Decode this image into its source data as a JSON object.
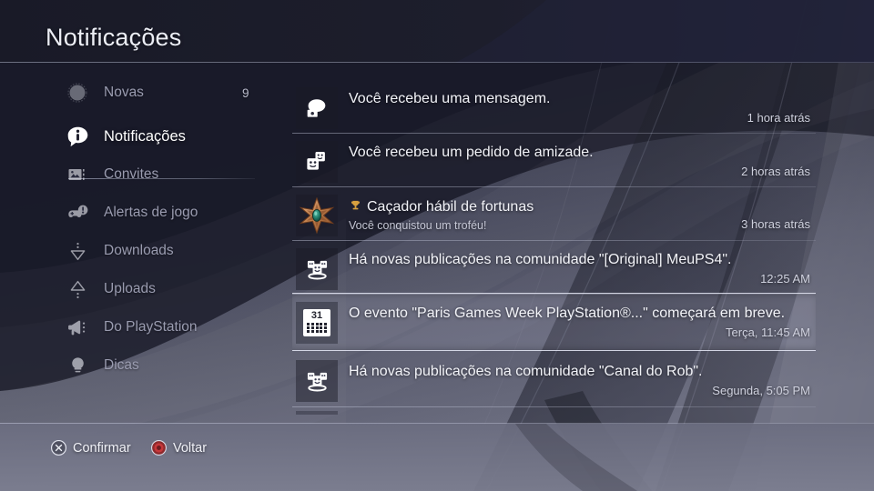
{
  "header": {
    "title": "Notificações"
  },
  "sidebar": {
    "divider_after_index": 0,
    "items": [
      {
        "label": "Novas",
        "icon": "new-dot-icon",
        "badge": "9",
        "active": false
      },
      {
        "label": "Notificações",
        "icon": "info-bubble-icon",
        "badge": "",
        "active": true
      },
      {
        "label": "Convites",
        "icon": "ticket-icon",
        "badge": "",
        "active": false
      },
      {
        "label": "Alertas de jogo",
        "icon": "controller-alert-icon",
        "badge": "",
        "active": false
      },
      {
        "label": "Downloads",
        "icon": "download-arrow-icon",
        "badge": "",
        "active": false
      },
      {
        "label": "Uploads",
        "icon": "upload-arrow-icon",
        "badge": "",
        "active": false
      },
      {
        "label": "Do PlayStation",
        "icon": "megaphone-icon",
        "badge": "",
        "active": false
      },
      {
        "label": "Dicas",
        "icon": "lightbulb-icon",
        "badge": "",
        "active": false
      }
    ]
  },
  "notifications": {
    "items": [
      {
        "icon": "message-bubble-icon",
        "title": "Você recebeu uma mensagem.",
        "subtitle": "",
        "time": "1 hora atrás",
        "selected": false
      },
      {
        "icon": "friend-request-icon",
        "title": "Você recebeu um pedido de amizade.",
        "subtitle": "",
        "time": "2 horas atrás",
        "selected": false
      },
      {
        "icon": "trophy-badge-icon",
        "title": "Caçador hábil de fortunas",
        "title_prefix_icon": "trophy-cup-icon",
        "subtitle": "Você conquistou um troféu!",
        "time": "3 horas atrás",
        "selected": false
      },
      {
        "icon": "community-icon",
        "title": "Há novas publicações na comunidade \"[Original] MeuPS4\".",
        "subtitle": "",
        "time": "12:25 AM",
        "selected": false
      },
      {
        "icon": "calendar-icon",
        "icon_day": "31",
        "title": "O evento \"Paris Games Week PlayStation®...\" começará em breve.",
        "subtitle": "",
        "time": "Terça, 11:45 AM",
        "selected": true
      },
      {
        "icon": "community-icon",
        "title": "Há novas publicações na comunidade \"Canal do Rob\".",
        "subtitle": "",
        "time": "Segunda, 5:05 PM",
        "selected": false
      }
    ]
  },
  "footer": {
    "hints": [
      {
        "button": "cross-button-icon",
        "label": "Confirmar"
      },
      {
        "button": "circle-button-icon",
        "label": "Voltar"
      }
    ]
  },
  "colors": {
    "header_bg": "#1c1d2b",
    "accent_white": "#ffffff",
    "text_dim": "#9a9cb0",
    "circle_button_red": "#c6373a",
    "trophy_bronze": "#c98a52",
    "trophy_gem": "#1f6b5e"
  }
}
